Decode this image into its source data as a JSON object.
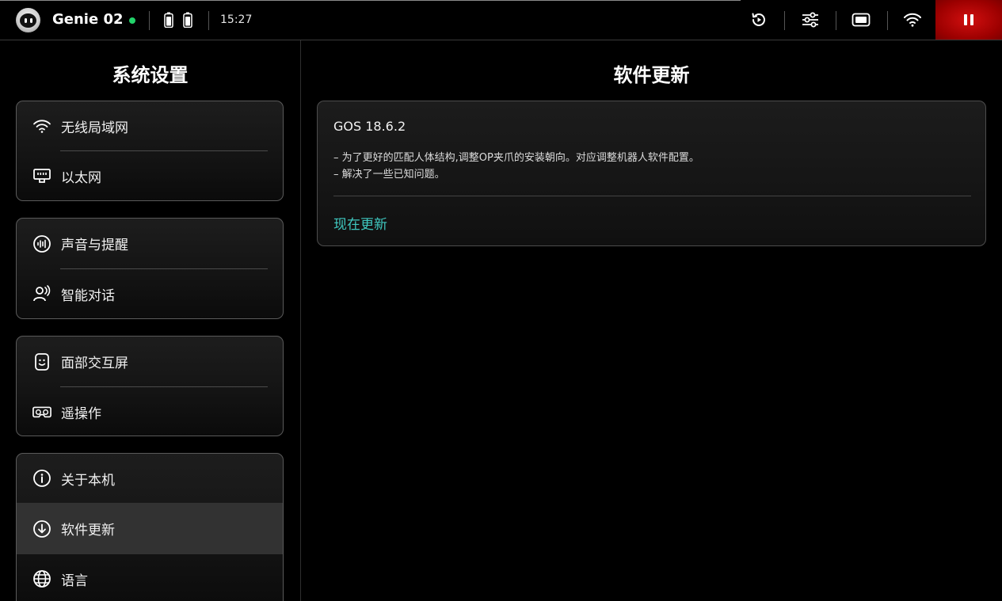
{
  "status_bar": {
    "device_name": "Genie 02",
    "time": "15:27",
    "online_color": "#22d36a",
    "icons": [
      "robot-avatar",
      "battery-icon",
      "battery-icon",
      "replay-icon",
      "sliders-icon",
      "screen-icon",
      "wifi-icon",
      "pause-icon"
    ]
  },
  "sidebar": {
    "title": "系统设置",
    "groups": [
      {
        "items": [
          {
            "label": "无线局域网",
            "icon": "wifi-icon"
          },
          {
            "label": "以太网",
            "icon": "ethernet-icon"
          }
        ]
      },
      {
        "items": [
          {
            "label": "声音与提醒",
            "icon": "sound-wave-icon"
          },
          {
            "label": "智能对话",
            "icon": "voice-person-icon"
          }
        ]
      },
      {
        "items": [
          {
            "label": "面部交互屏",
            "icon": "face-screen-icon"
          },
          {
            "label": "遥操作",
            "icon": "vr-headset-icon"
          }
        ]
      },
      {
        "items": [
          {
            "label": "关于本机",
            "icon": "info-icon"
          },
          {
            "label": "软件更新",
            "icon": "download-arrow-icon",
            "selected": true
          },
          {
            "label": "语言",
            "icon": "globe-icon"
          }
        ]
      }
    ]
  },
  "main": {
    "title": "软件更新",
    "update": {
      "version": "GOS 18.6.2",
      "notes": [
        "– 为了更好的匹配人体结构,调整OP夹爪的安装朝向。对应调整机器人软件配置。",
        "– 解决了一些已知问题。"
      ],
      "action_label": "现在更新",
      "action_color": "#3fc8c0"
    }
  },
  "colors": {
    "background": "#000000",
    "pause_button": "#c00000",
    "selected_item": "#323232"
  }
}
